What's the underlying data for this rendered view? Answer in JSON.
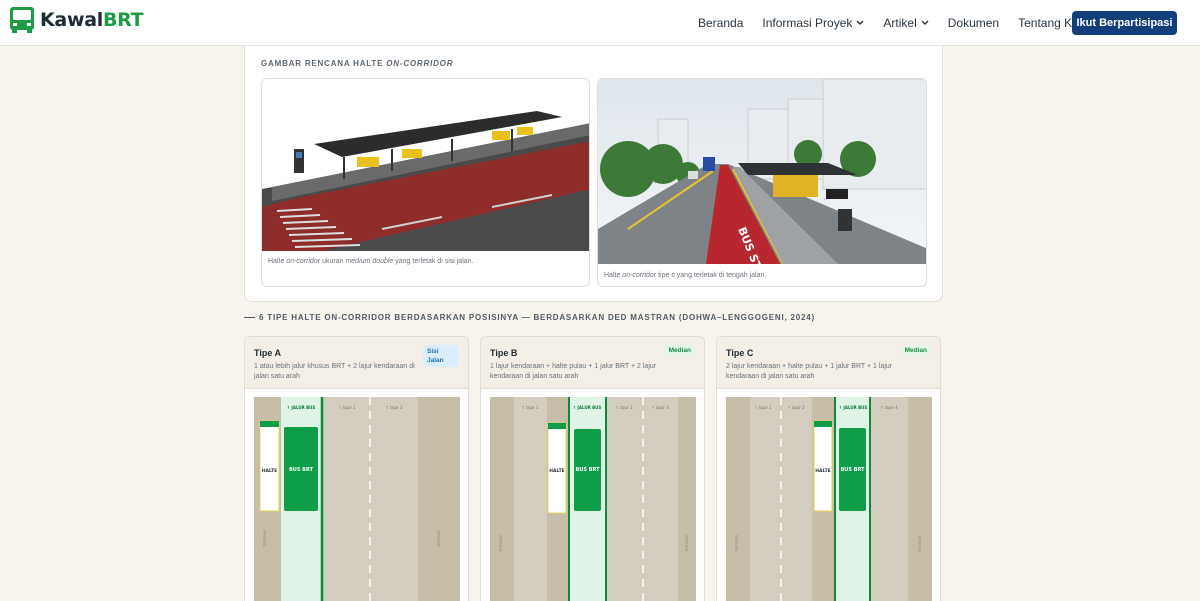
{
  "nav": {
    "logo_kawal": "Kawal",
    "logo_brt": "BRT",
    "links": [
      "Beranda",
      "Informasi Proyek",
      "Artikel",
      "Dokumen",
      "Tentang Kawal BRT"
    ],
    "cta": "Ikut Berpartisipasi"
  },
  "gallery": {
    "title_prefix": "GAMBAR RENCANA HALTE ",
    "title_italic": "ON-CORRIDOR",
    "fig1": {
      "cap_a": "Halte ",
      "cap_b": "on-corridor",
      "cap_c": " ukuran ",
      "cap_d": "medium double",
      "cap_e": " yang terletak di sisi jalan."
    },
    "fig2": {
      "cap_a": "Halte ",
      "cap_b": "on-corridor",
      "cap_c": " tipe c yang terletak di tengah jalan.",
      "bus_stop": "BUS STOP"
    }
  },
  "section_label": "6 TIPE HALTE ON-CORRIDOR BERDASARKAN POSISINYA — BERDASARKAN DED MASTRAN (DOHWA–LENGGOGENI, 2024)",
  "types": [
    {
      "name": "Tipe A",
      "badge": "Sisi Jalan",
      "desc": "1 atau lebih jalur khusus BRT + 2 lajur kendaraan di jalan satu arah",
      "lanes": [
        "↑ JALUR BUS",
        "↑ lajur 1",
        "↑ lajur 2"
      ],
      "halte": "HALTE",
      "bus": "BUS BRT",
      "sidewalk_l": "TROTOAR",
      "sidewalk_r": "TROTOAR"
    },
    {
      "name": "Tipe B",
      "badge": "Median",
      "desc": "1 lajur kendaraan + halte pulau + 1 jalur BRT + 2 lajur kendaraan di jalan satu arah",
      "lanes": [
        "↑ lajur 1",
        "↑ JALUR BUS",
        "↑ lajur 2",
        "↑ lajur 3"
      ],
      "halte": "HALTE",
      "bus": "BUS BRT",
      "sidewalk_l": "TROTOAR",
      "sidewalk_r": "TROTOAR"
    },
    {
      "name": "Tipe C",
      "badge": "Median",
      "desc": "2 lajur kendaraan + halte pulau + 1 jalur BRT + 1 lajur kendaraan di jalan satu arah",
      "lanes": [
        "↑ lajur 1",
        "↑ lajur 2",
        "↑ JALUR BUS",
        "↑ lajur 4"
      ],
      "halte": "HALTE",
      "bus": "BUS BRT",
      "sidewalk_l": "TROTOAR",
      "sidewalk_r": "TROTOAR"
    }
  ],
  "colors": {
    "brand_green": "#1e9c45",
    "navy": "#123f7a",
    "asphalt": "#d3cdbf",
    "sidewalk": "#c7bea9",
    "bus_lane": "#dff3e6",
    "bus": "#0e9d48"
  }
}
